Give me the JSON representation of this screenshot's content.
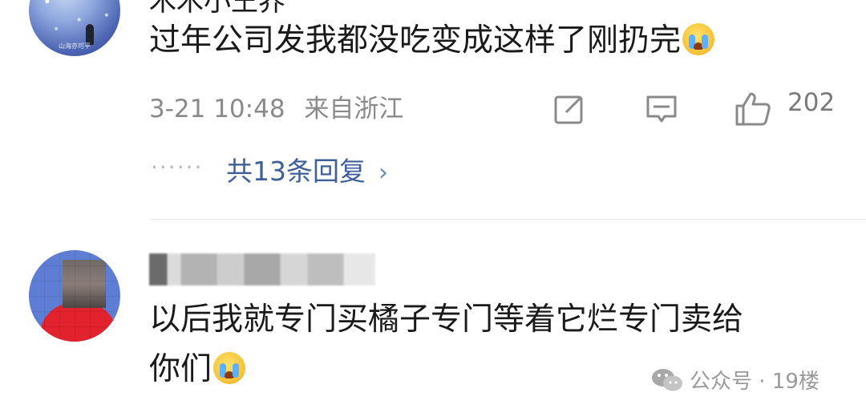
{
  "comments": [
    {
      "username": "木木小王养",
      "avatar_watermark": "山海亦可平",
      "text": "过年公司发我都没吃变成这样了刚扔完",
      "emoji": "crying-face-emoji",
      "timestamp": "3-21 10:48",
      "location": "来自浙江",
      "likes": "202",
      "replies_dots": "······",
      "replies_label": "共13条回复",
      "replies_chevron": "›",
      "icons": {
        "share": "share-edit-icon",
        "comment": "comment-bubble-icon",
        "like": "thumbs-up-icon"
      }
    },
    {
      "username_blurred": true,
      "text_line1": "以后我就专门买橘子专门等着它烂专门卖给",
      "text_line2": "你们",
      "emoji": "crying-face-emoji"
    }
  ],
  "watermark": {
    "icon": "wechat-icon",
    "label": "公众号 · 19楼"
  },
  "colors": {
    "reply_link": "#3f5f99",
    "meta_text": "#8a8a8a",
    "body_text": "#1a1a1a"
  }
}
